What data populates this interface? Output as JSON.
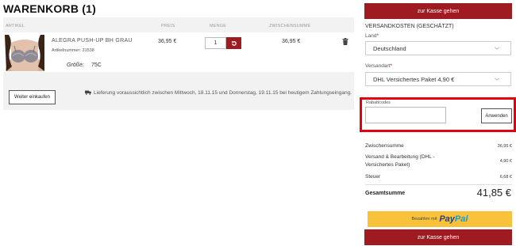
{
  "cart": {
    "title": "WARENKORB (1)",
    "columns": {
      "article": "ARTIKEL",
      "price": "PREIS",
      "quantity": "MENGE",
      "subtotal": "ZWISCHENSUMME"
    },
    "item": {
      "name": "ALEGRA PUSH-UP BH GRAU",
      "article_number": "Artikelnummer: 31538",
      "size_label": "Größe:",
      "size_value": "75C",
      "price": "36,95 €",
      "quantity": "1",
      "subtotal": "36,95 €"
    },
    "continue_label": "Weiter einkaufen",
    "delivery_text": "Lieferung voraussichtlich zwischen Mittwoch, 18.11.15 und Donnerstag, 19.11.15 bei heutigem Zahlungseingang."
  },
  "summary": {
    "checkout_label": "zur Kasse gehen",
    "shipping_title": "VERSANDKOSTEN (GESCHÄTZT)",
    "country_label": "Land",
    "country_value": "Deutschland",
    "shipping_label": "Versandart",
    "shipping_value": "DHL Versichertes Paket 4,90 €",
    "required_mark": "*",
    "coupon_label": "Rabattcodes",
    "coupon_placeholder": "",
    "apply_label": "Anwenden",
    "subtotal_label": "Zwischensumme",
    "subtotal_value": "36,95 €",
    "shipping_cost_label": "Versand & Bearbeitung (DHL - Versichertes Paket)",
    "shipping_cost_value": "4,90 €",
    "tax_label": "Steuer",
    "tax_value": "6,68 €",
    "total_label": "Gesamtsumme",
    "total_value": "41,85 €",
    "paypal_prefix": "Bezahlen mit",
    "paypal_logo_1": "Pay",
    "paypal_logo_2": "Pal"
  },
  "colors": {
    "accent": "#9e1b22",
    "highlight": "#e3000f",
    "paypal_bg": "#f8c33a"
  },
  "icons": {
    "refresh": "refresh-icon",
    "trash": "trash-icon",
    "truck": "truck-icon",
    "chevron": "chevron-down-icon"
  }
}
